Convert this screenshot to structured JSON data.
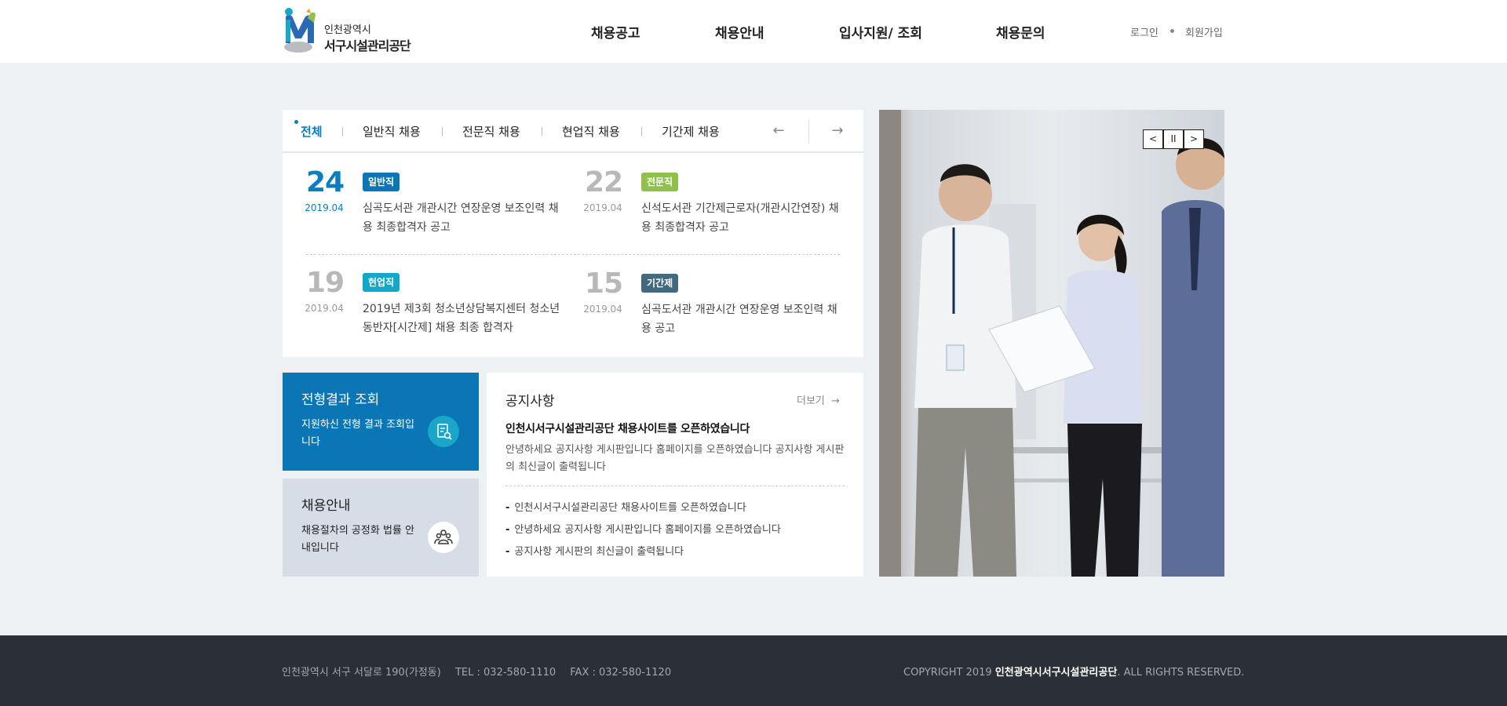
{
  "header": {
    "logo_sub": "인천광역시",
    "logo_main": "서구시설관리공단",
    "nav": [
      "채용공고",
      "채용안내",
      "입사지원/ 조회",
      "채용문의"
    ],
    "login": "로그인",
    "signup": "회원가입"
  },
  "recruit": {
    "tabs": [
      "전체",
      "일반직 채용",
      "전문직 채용",
      "현업직 채용",
      "기간제 채용"
    ],
    "prev": "←",
    "next": "→",
    "posts": [
      {
        "day": "24",
        "ym": "2019.04",
        "badge": "일반직",
        "badge_color": "#0a76b5",
        "title": "심곡도서관 개관시간 연장운영 보조인력 채용 최종합격자 공고"
      },
      {
        "day": "22",
        "ym": "2019.04",
        "badge": "전문직",
        "badge_color": "#8fc04a",
        "title": "신석도서관 기간제근로자(개관시간연장) 채용 최종합격자 공고"
      },
      {
        "day": "19",
        "ym": "2019.04",
        "badge": "현업직",
        "badge_color": "#13a8c9",
        "title": "2019년 제3회 청소년상담복지센터 청소년 동반자[시간제] 채용 최종 합격자"
      },
      {
        "day": "15",
        "ym": "2019.04",
        "badge": "기간제",
        "badge_color": "#416a80",
        "title": "심곡도서관 개관시간 연장운영 보조인력 채용 공고"
      }
    ]
  },
  "cards": {
    "result": {
      "title": "전형결과 조회",
      "desc": "지원하신 전형 결과 조회입니다",
      "icon": "document-search-icon"
    },
    "guide": {
      "title": "채용안내",
      "desc": "채용절차의 공정화 법률 안내입니다",
      "icon": "people-icon"
    }
  },
  "notice": {
    "title": "공지사항",
    "more": "더보기",
    "headline": "인천시서구시설관리공단 채용사이트를 오픈하였습니다",
    "body": "안녕하세요 공지사항 게시판입니다 홈페이지를 오픈하였습니다 공지사항 게시판의 최신글이 출력됩니다",
    "items": [
      "인천시서구시설관리공단 채용사이트를 오픈하였습니다",
      "안녕하세요 공지사항 게시판입니다 홈페이지를 오픈하였습니다",
      "공지사항 게시판의 최신글이 출력됩니다"
    ]
  },
  "slider": {
    "prev": "<",
    "pause": "II",
    "next": ">"
  },
  "footer": {
    "address": "인천광역시 서구 서달로 190(가정동)",
    "tel": "TEL : 032-580-1110",
    "fax": "FAX : 032-580-1120",
    "copy_prefix": "COPYRIGHT  2019",
    "copy_org": "인천광역시서구시설관리공단",
    "copy_suffix": ". ALL RIGHTS RESERVED."
  },
  "colors": {
    "primary": "#0a76b5",
    "background": "#edf1f4",
    "footer": "#2b2f36"
  }
}
